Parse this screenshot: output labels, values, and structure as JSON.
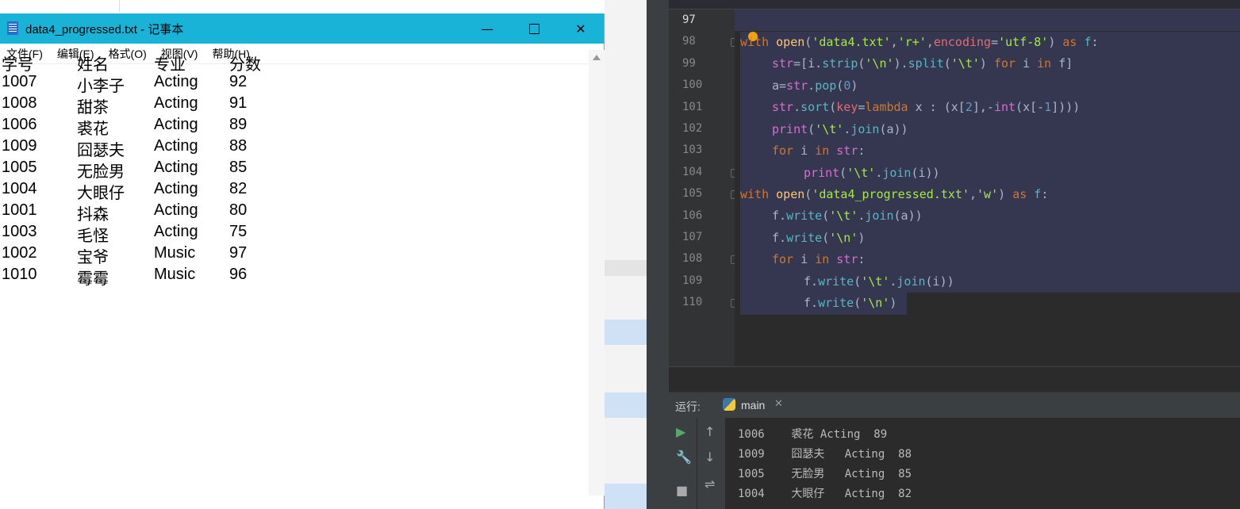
{
  "notepad": {
    "title": "data4_progressed.txt - 记事本",
    "menu": [
      "文件(F)",
      "编辑(E)",
      "格式(O)",
      "视图(V)",
      "帮助(H)"
    ],
    "rows": [
      [
        "学号",
        "姓名",
        "专业",
        "分数"
      ],
      [
        "1007",
        "小李子",
        "Acting",
        "92"
      ],
      [
        "1008",
        "甜茶",
        "Acting",
        "91"
      ],
      [
        "1006",
        "裘花",
        "Acting",
        "89"
      ],
      [
        "1009",
        "囧瑟夫",
        "Acting",
        "88"
      ],
      [
        "1005",
        "无脸男",
        "Acting",
        "85"
      ],
      [
        "1004",
        "大眼仔",
        "Acting",
        "82"
      ],
      [
        "1001",
        "抖森",
        "Acting",
        "80"
      ],
      [
        "1003",
        "毛怪",
        "Acting",
        "75"
      ],
      [
        "1002",
        "宝爷",
        "Music",
        "97"
      ],
      [
        "1010",
        "霉霉",
        "Music",
        "96"
      ]
    ]
  },
  "editor": {
    "line_numbers": [
      "97",
      "98",
      "99",
      "100",
      "101",
      "102",
      "103",
      "104",
      "105",
      "106",
      "107",
      "108",
      "109",
      "110"
    ]
  },
  "run": {
    "label": "运行:",
    "tab": "main",
    "console_lines": [
      "1006    裘花 Acting  89",
      "1009    囧瑟夫   Acting  88",
      "1005    无脸男   Acting  85",
      "1004    大眼仔   Acting  82"
    ]
  }
}
